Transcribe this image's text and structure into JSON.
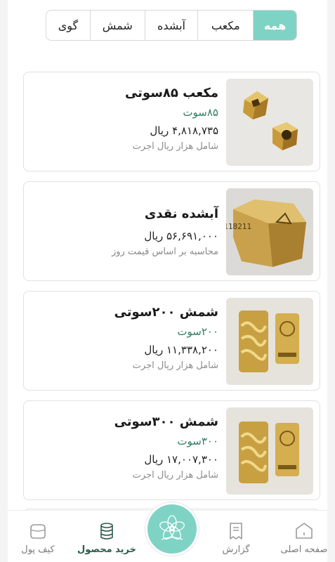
{
  "filters": [
    {
      "label": "همه",
      "active": true
    },
    {
      "label": "مکعب",
      "active": false
    },
    {
      "label": "آبشده",
      "active": false
    },
    {
      "label": "شمش",
      "active": false
    },
    {
      "label": "گوی",
      "active": false
    }
  ],
  "products": [
    {
      "name": "مکعب ۸۵سوتی",
      "weight": "۸۵سوت",
      "price": "۴,۸۱۸,۷۳۵ ریال",
      "note": "شامل هزار ریال اجرت",
      "image_icon": "gold-cubes-photo"
    },
    {
      "name": "آبشده نقدی",
      "weight": "",
      "price": "۵۶,۶۹۱,۰۰۰ ریال",
      "note": "محاسبه بر اساس قیمت روز",
      "image_icon": "melted-gold-photo"
    },
    {
      "name": "شمش ۲۰۰سوتی",
      "weight": "۲۰۰سوت",
      "price": "۱۱,۳۳۸,۲۰۰ ریال",
      "note": "شامل هزار ریال اجرت",
      "image_icon": "gold-bars-photo"
    },
    {
      "name": "شمش ۳۰۰سوتی",
      "weight": "۳۰۰سوت",
      "price": "۱۷,۰۰۷,۳۰۰ ریال",
      "note": "شامل هزار ریال اجرت",
      "image_icon": "gold-bars-photo"
    }
  ],
  "nav": {
    "home": {
      "label": "صفحه اصلی",
      "icon": "home-icon"
    },
    "report": {
      "label": "گزارش",
      "icon": "receipt-icon"
    },
    "buy": {
      "label": "خرید محصول",
      "icon": "coins-stack-icon"
    },
    "wallet": {
      "label": "کیف پول",
      "icon": "wallet-icon"
    },
    "center": {
      "icon": "brand-logo-flower"
    }
  },
  "colors": {
    "accent": "#7fd3c5",
    "weight_text": "#2f7d62",
    "active_nav": "#2a5d4b"
  }
}
